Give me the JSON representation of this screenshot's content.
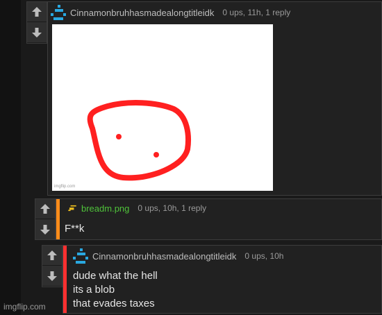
{
  "comments": [
    {
      "username": "Cinnamonbruhhasmadealongtitleidk",
      "meta": "0 ups, 11h, 1 reply",
      "image_watermark": "imgflip.com",
      "colors": {
        "accent": "#1d1d1d",
        "drawing": "#ff2020"
      }
    },
    {
      "username": "breadm.png",
      "meta": "0 ups, 10h, 1 reply",
      "text": "F**k",
      "colors": {
        "accent": "#ff8c1a",
        "username": "#4fc33a"
      }
    },
    {
      "username": "Cinnamonbruhhasmadealongtitleidk",
      "meta": "0 ups, 10h",
      "lines": [
        "dude what the hell",
        "its a blob",
        "that evades taxes"
      ],
      "colors": {
        "accent": "#ff3030"
      }
    }
  ],
  "icons": {
    "upvote": "arrow-up-icon",
    "downvote": "arrow-down-icon",
    "avatar": "pixel-avatar-icon"
  },
  "watermark": "imgflip.com"
}
